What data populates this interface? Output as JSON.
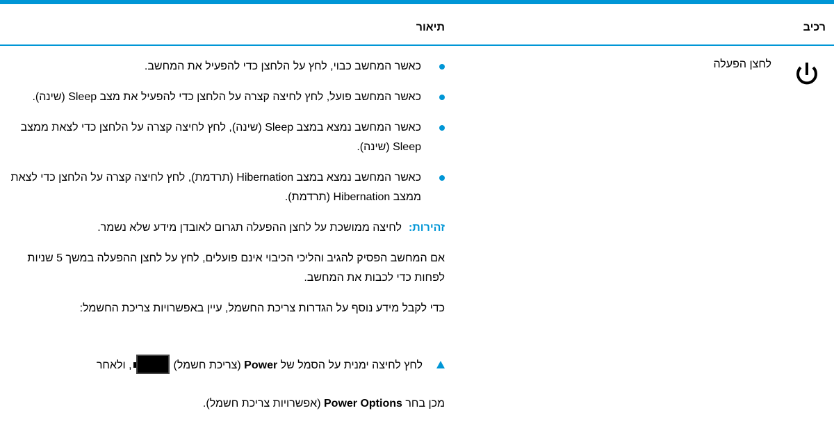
{
  "colors": {
    "accent": "#0096d6",
    "text": "#000000"
  },
  "table": {
    "header": {
      "component": "רכיב",
      "description": "תיאור"
    },
    "row": {
      "component_label": "לחצן הפעלה",
      "icon": "power-icon",
      "bullets": [
        "כאשר המחשב כבוי, לחץ על הלחצן כדי להפעיל את המחשב.",
        "כאשר המחשב פועל, לחץ לחיצה קצרה על הלחצן כדי להפעיל את מצב Sleep (שינה).",
        "כאשר המחשב נמצא במצב Sleep (שינה), לחץ לחיצה קצרה על הלחצן כדי לצאת ממצב Sleep (שינה).",
        "כאשר המחשב נמצא במצב Hibernation (תרדמת), לחץ לחיצה קצרה על הלחצן כדי לצאת ממצב Hibernation (תרדמת)."
      ],
      "warning_label": "זהירות:",
      "warning_text": "לחיצה ממושכת על לחצן ההפעלה תגרום לאובדן מידע שלא נשמר.",
      "paragraph_1": "אם המחשב הפסיק להגיב והליכי הכיבוי אינם פועלים, לחץ על לחצן ההפעלה במשך 5 שניות לפחות כדי לכבות את המחשב.",
      "paragraph_2": "כדי לקבל מידע נוסף על הגדרות צריכת החשמל, עיין באפשרויות צריכת החשמל:",
      "step_part_1": "לחץ לחיצה ימנית על הסמל של",
      "step_power_bold": "Power",
      "step_part_2": "(צריכת חשמל)",
      "step_part_3": ", ולאחר",
      "step_line_2_a": "מכן בחר",
      "step_options_bold": "Power Options",
      "step_line_2_b": "(אפשרויות צריכת חשמל).",
      "battery_icon": "battery-icon"
    }
  }
}
